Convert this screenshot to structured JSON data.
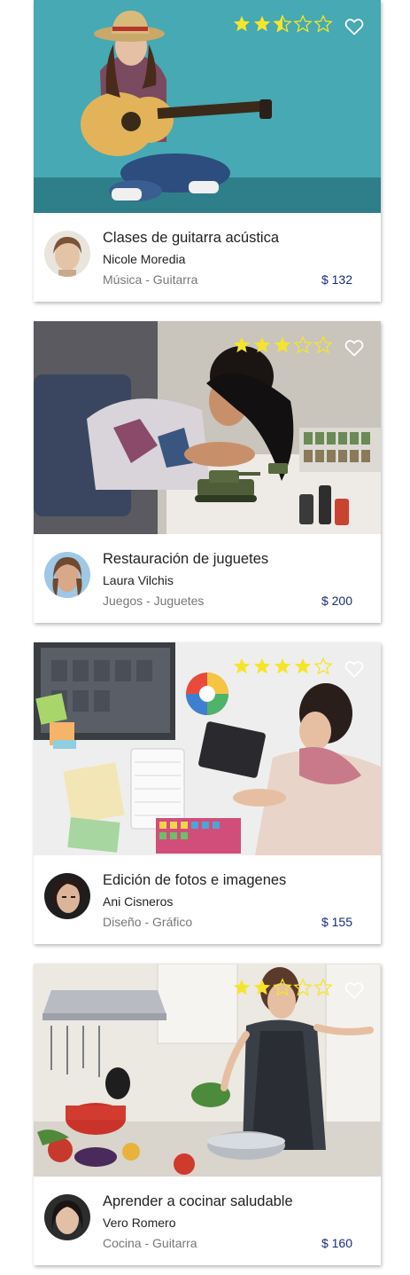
{
  "colors": {
    "star_fill": "#f5e52a",
    "star_empty_stroke": "#ffffff",
    "price": "#1a2a7a",
    "category": "#777777",
    "text": "#222222"
  },
  "cards": [
    {
      "title": "Clases de guitarra acústica",
      "author": "Nicole Moredia",
      "category": "Música - Guitarra",
      "price": "$ 132",
      "rating": 2.5,
      "rating_max": 5,
      "image": "woman-playing-guitar-photo",
      "avatar": "avatar-nicole"
    },
    {
      "title": "Restauración de juguetes",
      "author": "Laura Vilchis",
      "category": "Juegos - Juguetes",
      "price": "$ 200",
      "rating": 3,
      "rating_max": 5,
      "image": "woman-painting-toy-tank-photo",
      "avatar": "avatar-laura"
    },
    {
      "title": "Edición de fotos e imagenes",
      "author": "Ani Cisneros",
      "category": "Diseño - Gráfico",
      "price": "$ 155",
      "rating": 4,
      "rating_max": 5,
      "image": "woman-with-drawing-tablet-photo",
      "avatar": "avatar-ani"
    },
    {
      "title": "Aprender a cocinar saludable",
      "author": "Vero Romero",
      "category": "Cocina - Guitarra",
      "price": "$ 160",
      "rating": 2,
      "rating_max": 5,
      "image": "woman-cooking-photo",
      "avatar": "avatar-vero"
    }
  ]
}
